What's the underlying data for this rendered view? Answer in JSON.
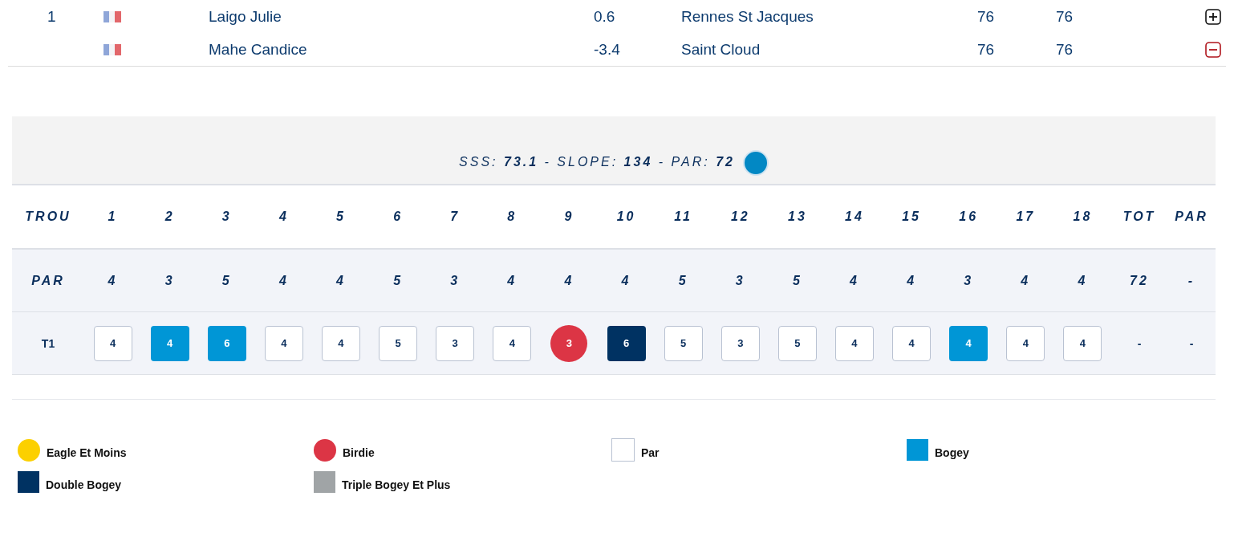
{
  "players": [
    {
      "rank": "1",
      "name": "Laigo Julie",
      "index": "0.6",
      "club": "Rennes St Jacques",
      "values": [
        "76",
        "76"
      ],
      "expanded": false
    },
    {
      "name": "Mahe Candice",
      "index": "-3.4",
      "club": "Saint Cloud",
      "values": [
        "76",
        "76"
      ],
      "expanded": true
    }
  ],
  "scorecard": {
    "summary": "SSS: **73.1** - SLOPE: **134** - PAR: **72**",
    "tee": {
      "color": "#0288c4"
    },
    "header": {
      "label": "TROU",
      "holes": [
        "1",
        "2",
        "3",
        "4",
        "5",
        "6",
        "7",
        "8",
        "9",
        "10",
        "11",
        "12",
        "13",
        "14",
        "15",
        "16",
        "17",
        "18"
      ],
      "total": "TOT",
      "par": "PAR"
    },
    "par_row": {
      "label": "PAR",
      "values": [
        "4",
        "3",
        "5",
        "4",
        "4",
        "5",
        "3",
        "4",
        "4",
        "4",
        "5",
        "3",
        "5",
        "4",
        "4",
        "3",
        "4",
        "4"
      ],
      "total": "72",
      "diff": "-"
    },
    "rounds": [
      {
        "label": "T1",
        "total": "-",
        "diff": "-",
        "scores": [
          {
            "value": "4",
            "kind": "par"
          },
          {
            "value": "4",
            "kind": "bogey"
          },
          {
            "value": "6",
            "kind": "bogey"
          },
          {
            "value": "4",
            "kind": "par"
          },
          {
            "value": "4",
            "kind": "par"
          },
          {
            "value": "5",
            "kind": "par"
          },
          {
            "value": "3",
            "kind": "par"
          },
          {
            "value": "4",
            "kind": "par"
          },
          {
            "value": "3",
            "kind": "birdie"
          },
          {
            "value": "6",
            "kind": "double_bogey"
          },
          {
            "value": "5",
            "kind": "par"
          },
          {
            "value": "3",
            "kind": "par"
          },
          {
            "value": "5",
            "kind": "par"
          },
          {
            "value": "4",
            "kind": "par"
          },
          {
            "value": "4",
            "kind": "par"
          },
          {
            "value": "4",
            "kind": "bogey"
          },
          {
            "value": "4",
            "kind": "par"
          },
          {
            "value": "4",
            "kind": "par"
          }
        ]
      }
    ]
  },
  "legend": [
    {
      "label": "Eagle Et Moins",
      "kind": "eagle"
    },
    {
      "label": "Birdie",
      "kind": "birdie"
    },
    {
      "label": "Par",
      "kind": "par"
    },
    {
      "label": "Bogey",
      "kind": "bogey"
    },
    {
      "label": "Double Bogey",
      "kind": "double_bogey"
    },
    {
      "label": "Triple Bogey Et Plus",
      "kind": "triple"
    }
  ]
}
